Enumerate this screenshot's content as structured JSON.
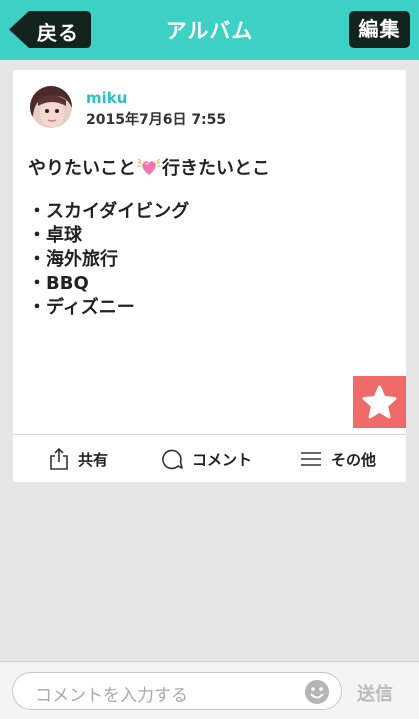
{
  "navbar": {
    "back_label": "戻る",
    "title": "アルバム",
    "edit_label": "編集"
  },
  "post": {
    "username": "miku",
    "datetime": "2015年7月6日 7:55",
    "title_before": "やりたいこと",
    "title_after": "行きたいとこ",
    "bullet": "・",
    "items": [
      "スカイダイビング",
      "卓球",
      "海外旅行",
      "BBQ",
      "ディズニー"
    ]
  },
  "actions": {
    "share_label": "共有",
    "comment_label": "コメント",
    "other_label": "その他"
  },
  "comment_bar": {
    "placeholder": "コメントを入力する",
    "send_label": "送信"
  },
  "colors": {
    "accent": "#3dd1c6",
    "username": "#29c4c2",
    "favorite": "#f06a6a",
    "nav_button": "#13241f"
  }
}
